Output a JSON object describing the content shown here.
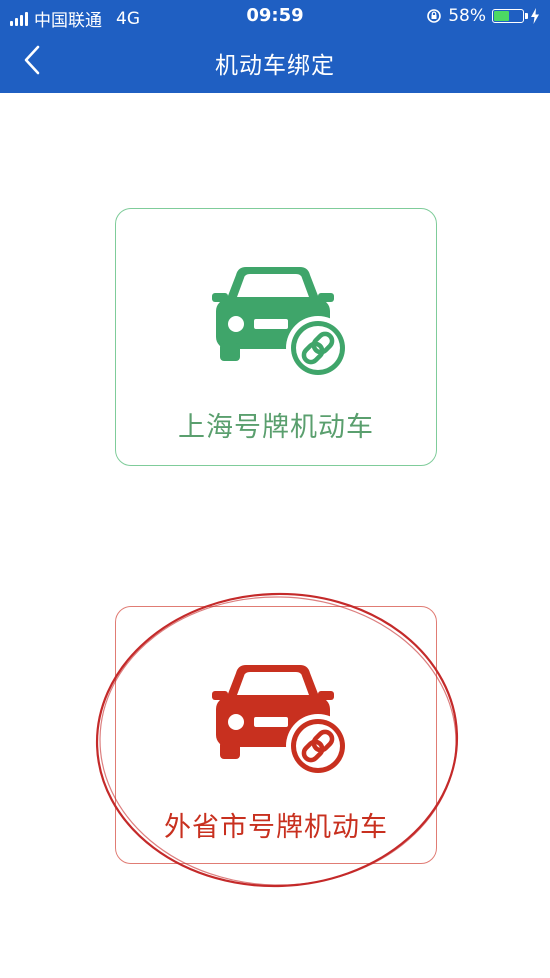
{
  "status_bar": {
    "carrier": "中国联通",
    "network": "4G",
    "time": "09:59",
    "battery_percent": "58%",
    "battery_level": 0.58,
    "icons": [
      "signal-icon",
      "rotation-lock-icon",
      "battery-icon",
      "charging-bolt-icon"
    ]
  },
  "header": {
    "title": "机动车绑定",
    "back_icon": "chevron-left-icon"
  },
  "options": [
    {
      "label": "上海号牌机动车",
      "icon": "car-link-icon",
      "color": "#3fa56a"
    },
    {
      "label": "外省市号牌机动车",
      "icon": "car-link-icon",
      "color": "#c8301f"
    }
  ],
  "colors": {
    "header_bg": "#1f5fc2",
    "local_accent": "#3fa56a",
    "other_accent": "#c8301f",
    "annotation": "#c42a2a"
  }
}
